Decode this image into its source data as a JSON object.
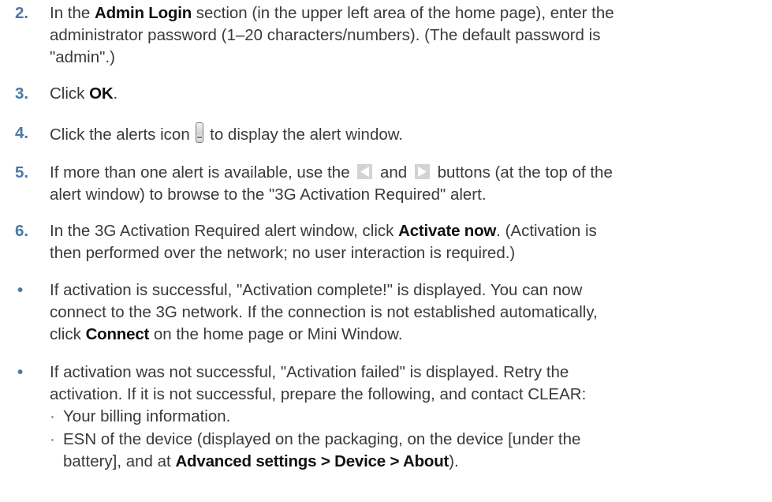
{
  "steps": {
    "s2": {
      "number": "2.",
      "t1": "In the ",
      "b1": "Admin Login",
      "t2": " section (in the upper left area of the home page), enter the",
      "t3": "administrator password (1–20 characters/numbers). (The default password is",
      "t4": "\"admin\".)"
    },
    "s3": {
      "number": "3.",
      "t1": "Click ",
      "b1": "OK",
      "t2": "."
    },
    "s4": {
      "number": "4.",
      "t1": "Click the alerts icon ",
      "t2": " to display the alert window.",
      "icon": "alert-exclamation-icon"
    },
    "s5": {
      "number": "5.",
      "t1": "If more than one alert is available, use the ",
      "t2": " and ",
      "t3": " buttons (at the top of the",
      "t4": "alert window) to browse to the \"3G Activation Required\" alert.",
      "icons": [
        "previous-arrow-icon",
        "next-arrow-icon"
      ]
    },
    "s6": {
      "number": "6.",
      "t1": "In the 3G Activation Required alert window, click ",
      "b1": "Activate now",
      "t2": ". (Activation is",
      "t3": "then performed over the network; no user interaction is required.)"
    }
  },
  "bullets": {
    "b1": {
      "mark": "•",
      "l1": "If activation is successful, \"Activation complete!\" is displayed. You can now",
      "l2": "connect to the 3G network. If the connection is not established automatically,",
      "l3a": "click ",
      "l3b": "Connect",
      "l3c": " on the home page or Mini Window."
    },
    "b2": {
      "mark": "•",
      "l1": "If activation was not successful, \"Activation failed\" is displayed. Retry the",
      "l2": "activation. If it is not successful, prepare the following, and contact CLEAR:",
      "subs": {
        "mark": "·",
        "sub1": "Your billing information.",
        "sub2_l1": "ESN of the device (displayed on the packaging, on the device [under the",
        "sub2_l2a": "battery], and at ",
        "sub2_l2b": "Advanced settings > Device > About",
        "sub2_l2c": ")."
      }
    }
  },
  "colors": {
    "step_number": "#4a78a8",
    "body_text": "#3a3a3a",
    "bold_text": "#111111"
  }
}
